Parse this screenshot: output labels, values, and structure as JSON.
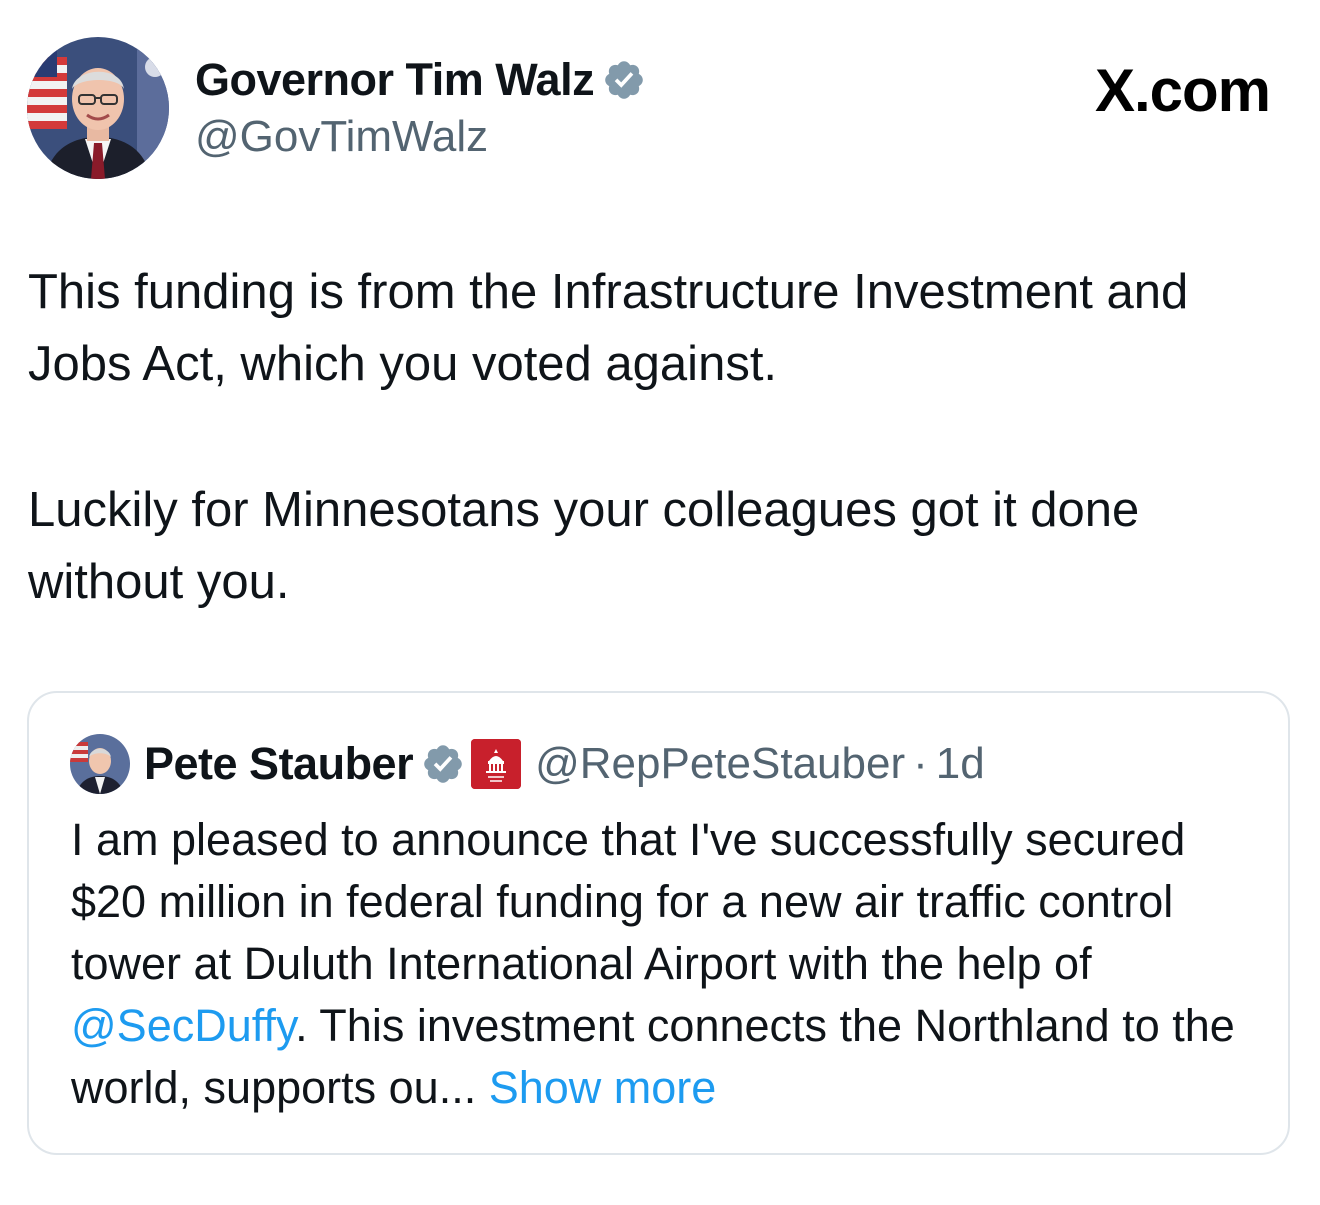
{
  "author": {
    "name": "Governor Tim Walz",
    "handle": "@GovTimWalz",
    "verified": true
  },
  "site": {
    "label": "X.com"
  },
  "tweet": {
    "paragraph_1": "This funding is from the Infrastructure Investment and Jobs Act, which you voted against.",
    "paragraph_2": "Luckily for Minnesotans your colleagues got it done without you."
  },
  "quote": {
    "name": "Pete Stauber",
    "verified": true,
    "affiliation_badge_icon": "house-gop-badge-icon",
    "handle": "@RepPeteStauber",
    "separator": "·",
    "time": "1d",
    "text_before_mention": "I am pleased to announce that I've successfully secured $20 million in federal funding for a new air traffic control tower at Duluth International Airport with the help of ",
    "mention": "@SecDuffy",
    "text_after_mention": ". This investment connects the Northland to the world, supports ou... ",
    "show_more": "Show more"
  },
  "colors": {
    "text": "#0f1419",
    "secondary": "#536471",
    "link": "#1d9bf0",
    "border": "#dfe5ea",
    "verified_badge": "#829aab",
    "gop_badge": "#c8202c"
  }
}
